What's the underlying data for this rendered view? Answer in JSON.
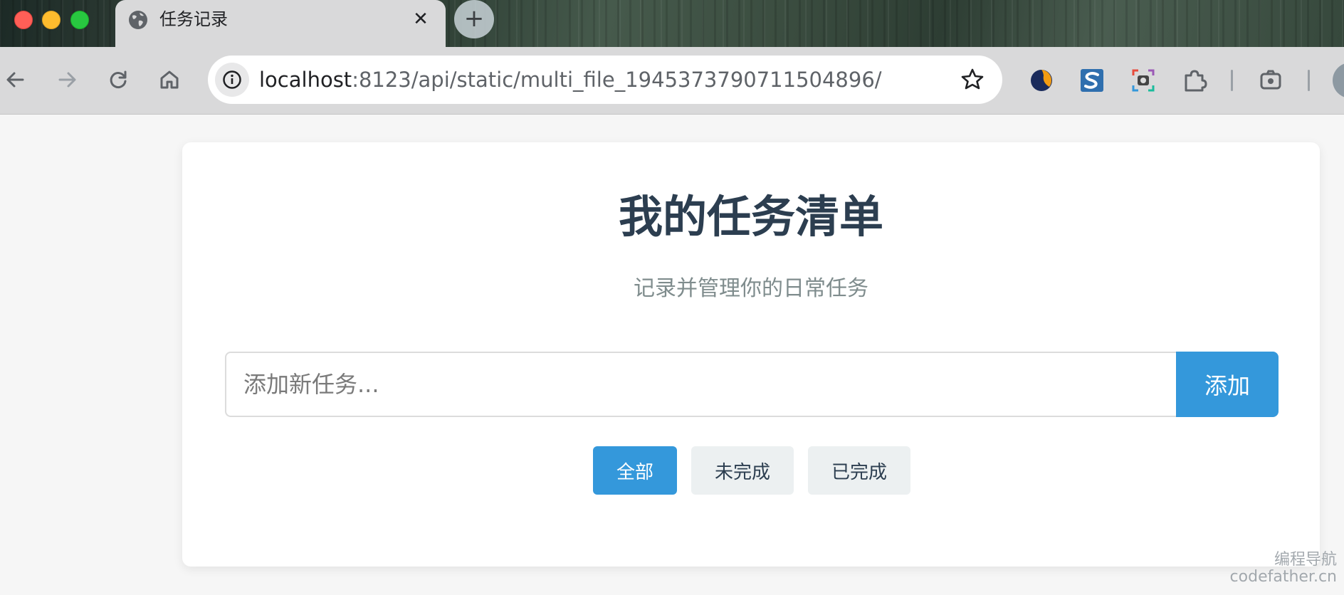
{
  "browser": {
    "tab": {
      "title": "任务记录",
      "close_symbol": "✕",
      "favicon": "globe-icon"
    },
    "new_tab_symbol": "+",
    "address_bar": {
      "host": "localhost",
      "path": ":8123/api/static/multi_file_1945373790711504896/"
    },
    "extensions": [
      "swirl-extension-icon",
      "s-extension-icon",
      "screenshot-extension-icon",
      "puzzle-extensions-icon",
      "screen-capture-icon"
    ]
  },
  "page": {
    "title": "我的任务清单",
    "subtitle": "记录并管理你的日常任务",
    "task_input": {
      "placeholder": "添加新任务...",
      "value": ""
    },
    "add_button_label": "添加",
    "filters": [
      {
        "label": "全部",
        "active": true
      },
      {
        "label": "未完成",
        "active": false
      },
      {
        "label": "已完成",
        "active": false
      }
    ]
  },
  "watermark": {
    "line1": "编程导航",
    "line2": "codefather.cn"
  },
  "colors": {
    "accent": "#3498db",
    "title": "#2c3e50",
    "subtitle": "#7f8c8d",
    "filter_inactive_bg": "#ecf0f1"
  }
}
